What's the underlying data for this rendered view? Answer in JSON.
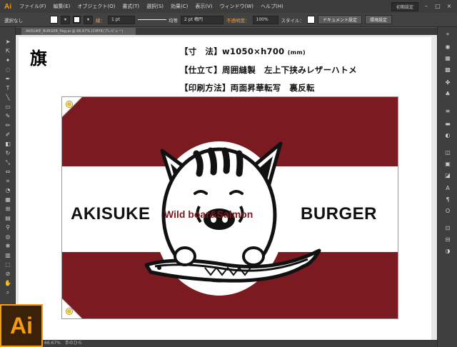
{
  "app": {
    "logo_text": "Ai",
    "menu": [
      "ファイル(F)",
      "編集(E)",
      "オブジェクト(O)",
      "書式(T)",
      "選択(S)",
      "効果(C)",
      "表示(V)",
      "ウィンドウ(W)",
      "ヘルプ(H)"
    ],
    "workspace_label": "初期設定",
    "accent_color": "#f29b13"
  },
  "control": {
    "selection": "選択なし",
    "stroke_label": "線：",
    "stroke_weight": "1 pt",
    "stroke_style": "均等",
    "brush": "2 pt 楕円",
    "opacity_label": "不透明度：",
    "opacity_value": "100%",
    "style_label": "スタイル：",
    "doc_setup": "ドキュメント設定",
    "prefs": "環境設定"
  },
  "document": {
    "tab_label": "AKISUKE_BURGER_flag.ai @ 66.67% (CMYK/プレビュー)",
    "title": "旗",
    "spec_size": "【寸　法】w1050×h700",
    "spec_size_unit": "(mm)",
    "spec_finish": "【仕立て】周囲縫製　左上下挟みレザーハトメ",
    "spec_print": "【印刷方法】両面昇華転写　裏反転"
  },
  "flag": {
    "brand_left": "AKISUKE",
    "brand_right": "BURGER",
    "tagline": "Wild boar&Salmon",
    "band_color": "#7b1a21"
  },
  "status": {
    "zoom": "66.67%",
    "tool": "手のひら"
  }
}
